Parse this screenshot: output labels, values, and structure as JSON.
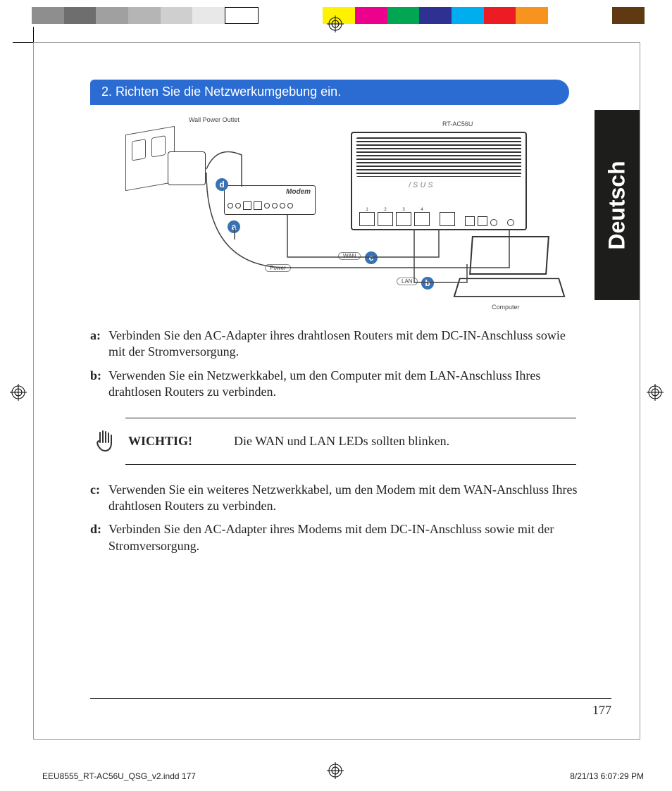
{
  "colorbar": [
    "#8e8e8e",
    "#6e6e6e",
    "#a0a0a0",
    "#b5b5b5",
    "#cfcfcf",
    "#e8e8e8",
    "#ffffff",
    "#ffffff",
    "#fff200",
    "#ec008c",
    "#00a651",
    "#2e3192",
    "#00aeef",
    "#ed1c24",
    "#f7941d",
    "#ffffff",
    "#ffffff",
    "#603913"
  ],
  "heading": "2.  Richten Sie die Netzwerkumgebung ein.",
  "language_tab": "Deutsch",
  "diagram": {
    "labels": {
      "wall_outlet": "Wall Power Outlet",
      "router_model": "RT-AC56U",
      "modem": "Modem",
      "computer": "Computer",
      "wan": "WAN",
      "lan": "LAN",
      "power": "Power",
      "router_logo": "/SUS"
    },
    "callouts": [
      "a",
      "b",
      "c",
      "d"
    ]
  },
  "instructions": [
    {
      "key": "a:",
      "text": "Verbinden Sie den AC-Adapter ihres drahtlosen Routers mit dem DC-IN-Anschluss sowie mit der Stromversorgung."
    },
    {
      "key": "b:",
      "text": "Verwenden Sie ein Netzwerkkabel, um den Computer mit dem LAN-Anschluss Ihres drahtlosen Routers zu verbinden."
    }
  ],
  "important": {
    "label": "WICHTIG!",
    "text": "Die WAN und LAN LEDs sollten blinken."
  },
  "instructions2": [
    {
      "key": "c:",
      "text": "Verwenden Sie ein weiteres Netzwerkkabel, um den Modem mit dem WAN-Anschluss Ihres drahtlosen Routers zu verbinden."
    },
    {
      "key": "d:",
      "text": "Verbinden Sie den AC-Adapter ihres Modems mit dem DC-IN-Anschluss sowie mit der Stromversorgung."
    }
  ],
  "page_number": "177",
  "print_footer": {
    "left": "EEU8555_RT-AC56U_QSG_v2.indd   177",
    "right": "8/21/13   6:07:29 PM"
  }
}
